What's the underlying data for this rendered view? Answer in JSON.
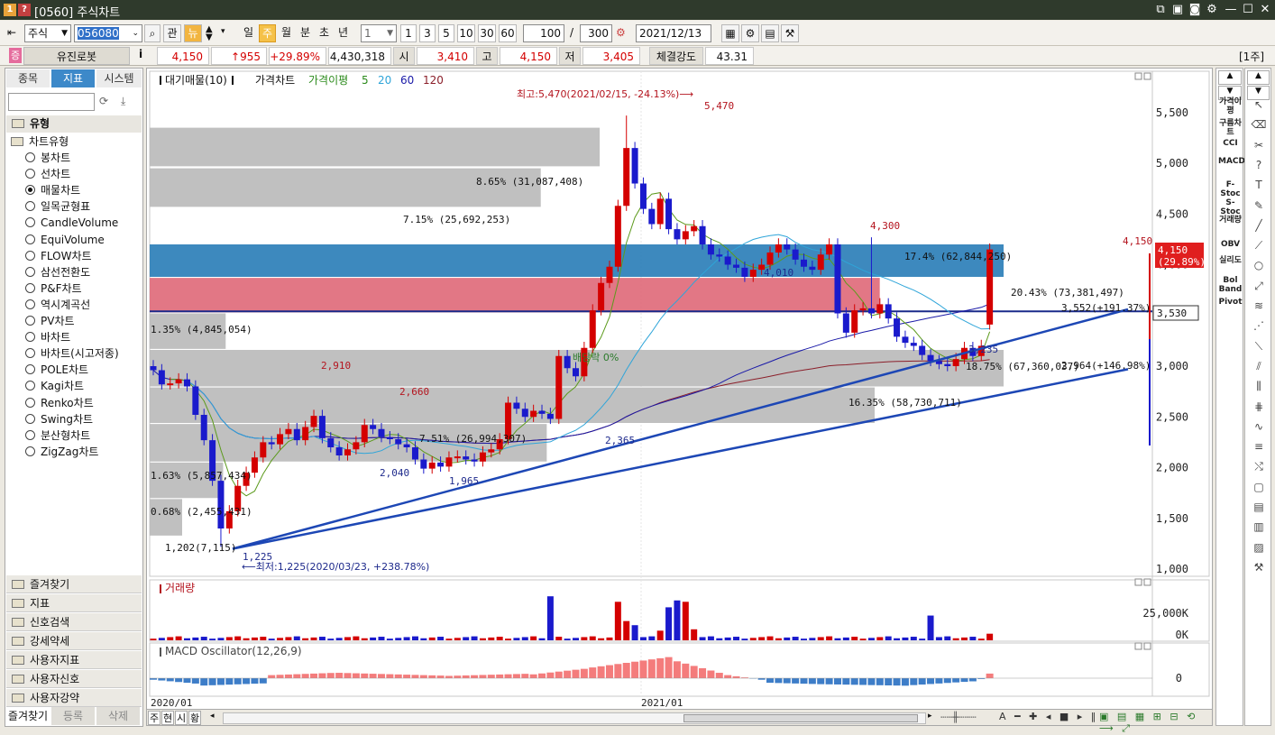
{
  "window": {
    "title": "[0560] 주식차트",
    "badge1": "1",
    "badge2": "?"
  },
  "toolbar": {
    "market": "주식",
    "code": "056080",
    "gwan": "관",
    "news": "뉴",
    "periods": [
      "일",
      "주",
      "월",
      "분",
      "초",
      "년"
    ],
    "active_period": "주",
    "interval": "1",
    "quick": [
      "1",
      "3",
      "5",
      "10",
      "30",
      "60"
    ],
    "count": "100",
    "total": "300",
    "date": "2021/12/13"
  },
  "quote": {
    "badge": "증",
    "name": "유진로봇",
    "info": "i",
    "price": "4,150",
    "change": "↑955",
    "rate": "+29.89%",
    "volume": "4,430,318",
    "open_label": "시",
    "open": "3,410",
    "high_label": "고",
    "high": "4,150",
    "low_label": "저",
    "low": "3,405",
    "strength_label": "체결강도",
    "strength": "43.31",
    "unit": "[1주]"
  },
  "left_panel": {
    "tabs": [
      "종목",
      "지표",
      "시스템"
    ],
    "active_tab": "지표",
    "section": "유형",
    "group": "차트유형",
    "types": [
      "봉차트",
      "선차트",
      "매물차트",
      "일목균형표",
      "CandleVolume",
      "EquiVolume",
      "FLOW차트",
      "삼선전환도",
      "P&F차트",
      "역시계곡선",
      "PV차트",
      "바차트",
      "바차트(시고저종)",
      "POLE차트",
      "Kagi차트",
      "Renko차트",
      "Swing차트",
      "분산형차트",
      "ZigZag차트"
    ],
    "selected_type": "매물차트",
    "folders": [
      "즐겨찾기",
      "지표",
      "신호검색",
      "강세약세",
      "사용자지표",
      "사용자신호",
      "사용자강약"
    ],
    "bottom_tabs": [
      "즐겨찾기",
      "등록",
      "삭제"
    ]
  },
  "chart": {
    "legend": {
      "vp": "대기매물(10)",
      "price": "가격차트",
      "ma_label": "가격이평",
      "ma5": "5",
      "ma20": "20",
      "ma60": "60",
      "ma120": "120"
    },
    "yaxis": [
      "5,500",
      "5,000",
      "4,500",
      "4,000",
      "3,500",
      "3,000",
      "2,500",
      "2,000",
      "1,500",
      "1,000"
    ],
    "price_tag": "4,150",
    "price_tag2": "(29.89%)",
    "last_box": "3,530",
    "annotations": {
      "high": "최고:5,470(2021/02/15, -24.13%)⟶",
      "low": "⟵최저:1,225(2020/03/23, +238.78%)",
      "dividend": "배당락 0%"
    },
    "point_labels": [
      "5,470",
      "4,300",
      "4,010",
      "4,150",
      "3,235",
      "2,910",
      "2,660",
      "2,040",
      "1,965",
      "2,365",
      "1,225"
    ],
    "vp_labels": [
      "8.65% (31,087,408)",
      "7.15% (25,692,253)",
      "17.4% (62,844,250)",
      "20.43% (73,381,497)",
      "1.35% (4,845,054)",
      "18.75% (67,360,037)",
      "16.35% (58,730,711)",
      "7.51% (26,994,307)",
      "1.63% (5,857,434)",
      "0.68% (2,455,431)"
    ],
    "line_labels": [
      "3,552(+191.37%)",
      "2,964(+146.98%)",
      "1,202(7,115)"
    ],
    "volume_title": "거래량",
    "volume_axis": [
      "25,000K",
      "0K"
    ],
    "macd_title": "MACD Oscillator(12,26,9)",
    "macd_axis": "0",
    "xaxis": [
      "2020/01",
      "2021/01"
    ]
  },
  "rside": [
    "가격이평",
    "구름차트",
    "CCI",
    "MACD",
    "F-Stoc",
    "S-Stoc",
    "거래량",
    "OBV",
    "실리도",
    "Bol Band",
    "Pivot"
  ],
  "status_tabs": [
    "주",
    "현",
    "시",
    "황"
  ],
  "colors": {
    "up": "#d40000",
    "down": "#1a1acc",
    "vp_high": "#2c7fb8",
    "vp_pink": "#e06b7b",
    "vp_gray": "#bdbdbd",
    "trend": "#1d47b5"
  }
}
